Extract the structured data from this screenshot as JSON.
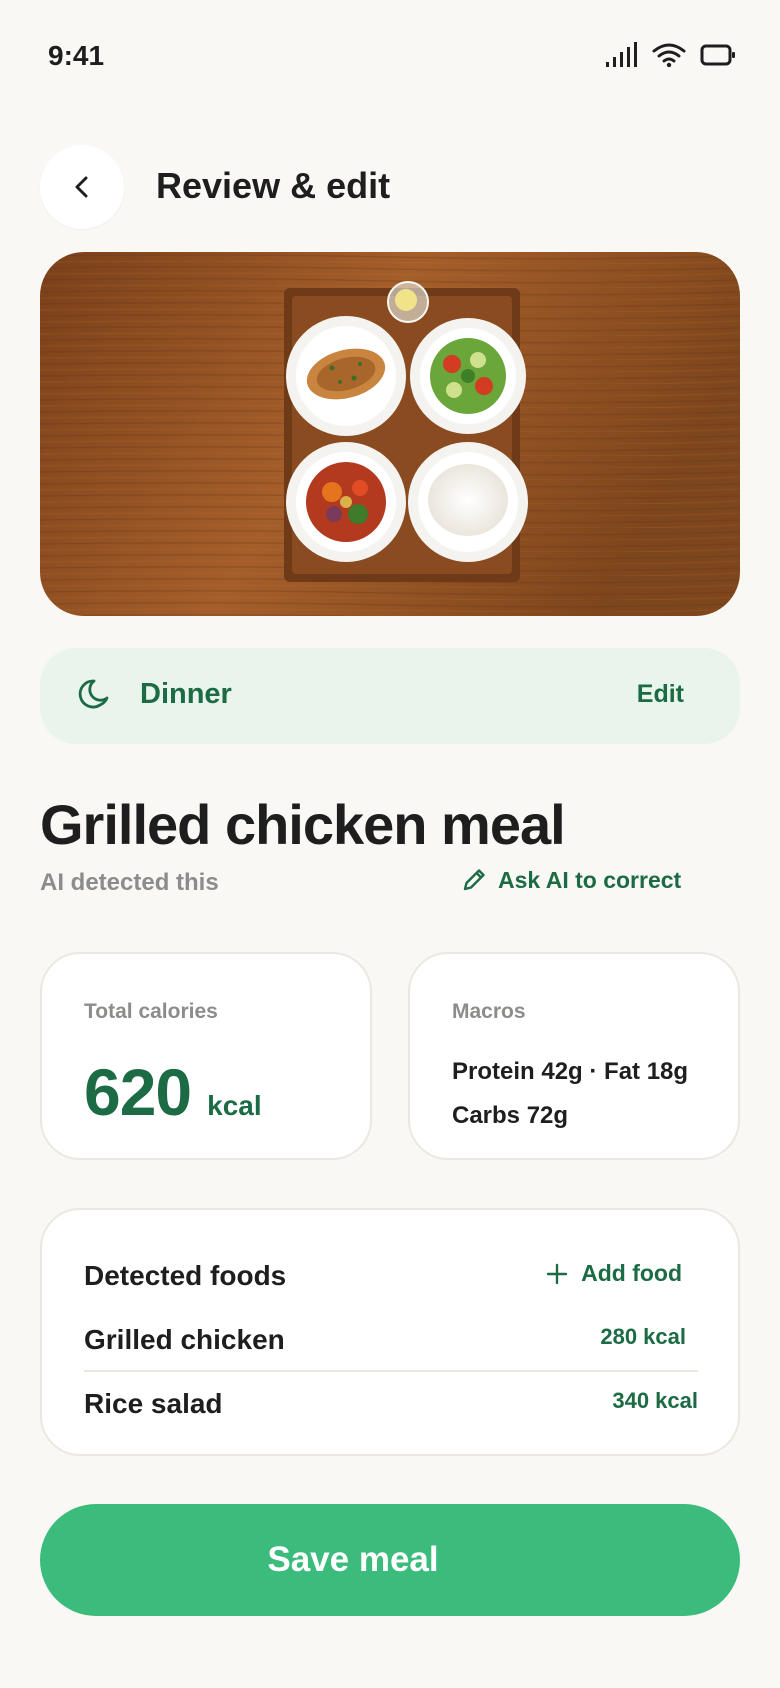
{
  "status_bar": {
    "time": "9:41",
    "icons": [
      "signal-icon",
      "wifi-icon",
      "battery-icon"
    ]
  },
  "header": {
    "back_icon": "chevron-left-icon",
    "title": "Review & edit"
  },
  "photo": {
    "subject": "meal-photo"
  },
  "meal_type": {
    "icon": "moon-icon",
    "label": "Dinner",
    "edit_label": "Edit"
  },
  "meal": {
    "name": "Grilled chicken meal",
    "detected_hint": "AI detected this",
    "ask_ai_label": "Ask AI to correct",
    "ask_ai_icon": "pencil-icon"
  },
  "calories": {
    "label": "Total calories",
    "value": "620",
    "unit": "kcal"
  },
  "macros": {
    "label": "Macros",
    "line1": "Protein 42g · Fat 18g",
    "line2": "Carbs 72g"
  },
  "foods": {
    "title": "Detected foods",
    "add_label": "Add food",
    "add_icon": "plus-icon",
    "items": [
      {
        "name": "Grilled chicken",
        "kcal": "280 kcal"
      },
      {
        "name": "Rice salad",
        "kcal": "340 kcal"
      }
    ]
  },
  "save_button": {
    "label": "Save meal"
  },
  "colors": {
    "background": "#faf8f5",
    "accent_dark": "#1c6b45",
    "accent_button": "#3bbb7c",
    "meal_type_bg": "#e9f4ec",
    "muted_text": "#8c8c8a"
  }
}
